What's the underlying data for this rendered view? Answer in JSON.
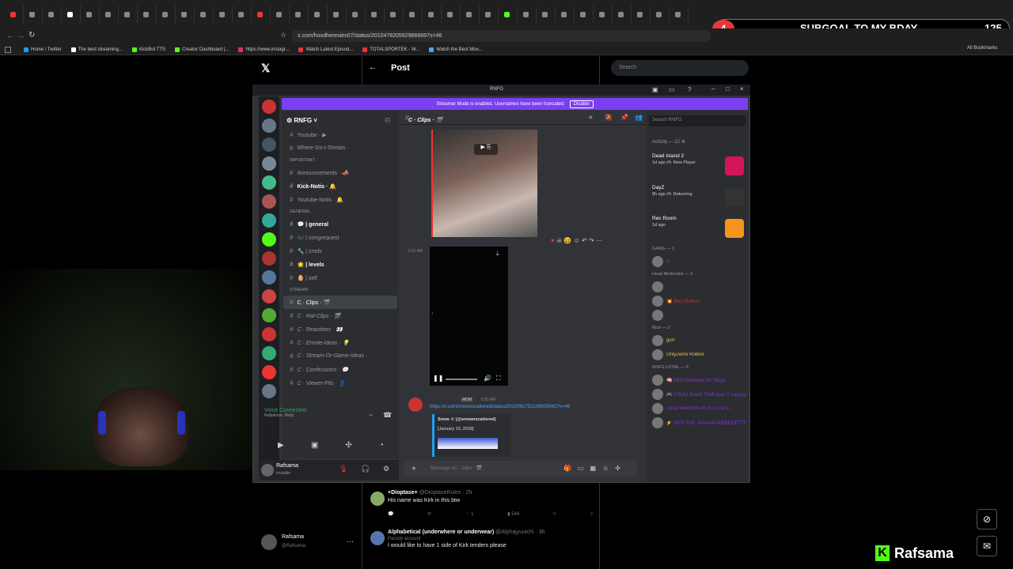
{
  "browser": {
    "url": "x.com/hoodheresies07/status/2010478205929666697s=46",
    "bookmarks": [
      "Home / Twitter",
      "The best streaming...",
      "KickBot TTS",
      "Creator Dashboard |...",
      "https://www.instagr...",
      "Watch Latest Episod...",
      "TOTALSPORTEK - W...",
      "Watch the Best Mov..."
    ],
    "all_bookmarks": "All Bookmarks",
    "bookmark_colors": [
      "#1d9bf0",
      "#fff",
      "#53fc18",
      "#53fc18",
      "#e1306c",
      "#e33",
      "#e33",
      "#4aa3ff"
    ]
  },
  "subgoal": {
    "number": "4",
    "title": "SUBGOAL TO MY BDAY",
    "count": "125"
  },
  "x": {
    "page_title": "Post",
    "search_placeholder": "Search",
    "account_name": "Rafsama",
    "account_handle": "@Rafsama",
    "replies": [
      {
        "name": "+Dioptase+",
        "handle": "@DioptaseRules · 2h",
        "text": "His name was Kirk in this btw",
        "stats": [
          "",
          "",
          "1",
          "548",
          "",
          ""
        ]
      },
      {
        "name": "Alphabetical (underwhere or underwear)",
        "handle": "@Alphajyuuichi · 3h",
        "badge": "Parody account",
        "text": "I would like to have 1 side of Kirk tenders please"
      }
    ]
  },
  "discord": {
    "window_title": "RNFG",
    "banner": "Streamer Mode is enabled. Usernames have been truncated.",
    "banner_button": "Disable",
    "server_name": "RNFG",
    "channels": [
      {
        "type": "ch",
        "label": "Youtube · ▶",
        "style": "dim"
      },
      {
        "type": "ch",
        "label": "Where-Do-I-Stream ·",
        "style": "dim"
      },
      {
        "type": "cat",
        "label": "Important ·"
      },
      {
        "type": "ch",
        "label": "Announcements · 📣",
        "style": "dim"
      },
      {
        "type": "ch",
        "label": "Kick-Notis · 🔔",
        "style": "bold"
      },
      {
        "type": "ch",
        "label": "Youtube-Notis · 🔔",
        "style": "dim"
      },
      {
        "type": "cat",
        "label": "GENERAL ·"
      },
      {
        "type": "ch",
        "label": "💬 | general",
        "style": "bold"
      },
      {
        "type": "ch",
        "label": "🎶 | songrequest",
        "style": "dim"
      },
      {
        "type": "ch",
        "label": "🔧 | cmds",
        "style": "dim"
      },
      {
        "type": "ch",
        "label": "🌟 | levels",
        "style": "bold"
      },
      {
        "type": "ch",
        "label": "🥚 | self",
        "style": "dim"
      },
      {
        "type": "cat",
        "label": "Stream ·"
      },
      {
        "type": "ch",
        "label": "C · Clips · 🎬",
        "style": "sel"
      },
      {
        "type": "ch",
        "label": "C · Raf-Clips · 🎬",
        "style": "ital"
      },
      {
        "type": "ch",
        "label": "C · Reactions · 👀",
        "style": "ital"
      },
      {
        "type": "ch",
        "label": "C · Emote-Ideas · 💡",
        "style": "ital"
      },
      {
        "type": "ch",
        "label": "C · Stream-Or-Game-Ideas ·",
        "style": "ital"
      },
      {
        "type": "ch",
        "label": "C · Confessions · 💬",
        "style": "ital"
      },
      {
        "type": "ch",
        "label": "C · Viewer-Fits · 👖",
        "style": "ital"
      }
    ],
    "voice": {
      "title": "Voice Connected",
      "sub": "Rafiphone, Molly"
    },
    "user": {
      "name": "Rafsama",
      "status": "Invisible"
    },
    "channel_header": "C · Clips · 🎬",
    "search_placeholder": "Search RNFG",
    "msg_time": "5:11 AM",
    "msg2": {
      "badge": "MOM",
      "time": "6:30 AM",
      "link": "https://x.com/snownscattered/status/2010061752109805942?s=46",
      "embed_author": "Snow ☆ (@snownscattered)",
      "embed_date": "[January 10, 2018]"
    },
    "input_placeholder": "Message #C · Clips · 🎬",
    "activity_header": "Activity — 22 ⚙",
    "games": [
      {
        "name": "Dead Island 2",
        "sub": "1d ago  🎮 New Player",
        "color": "#d4145a"
      },
      {
        "name": "DayZ",
        "sub": "8h ago  🎮 Returning",
        "color": "#333"
      },
      {
        "name": "Rec Room",
        "sub": "1d ago",
        "color": "#f7941d"
      }
    ],
    "members": [
      {
        "type": "h",
        "label": "GANG — 1"
      },
      {
        "type": "m",
        "label": "Z...",
        "color": "#c33"
      },
      {
        "type": "h",
        "label": "Head Moderator — 3"
      },
      {
        "type": "m",
        "label": "",
        "color": "#c33"
      },
      {
        "type": "m",
        "label": "💥 BAU  Roblox",
        "color": "#c33"
      },
      {
        "type": "m",
        "label": "",
        "color": "#c33"
      },
      {
        "type": "h",
        "label": "Rich — 2"
      },
      {
        "type": "m",
        "label": "gurt",
        "color": "#f5c542"
      },
      {
        "type": "m",
        "label": "OnlyZenni  Roblox",
        "color": "#f5c542"
      },
      {
        "type": "h",
        "label": "RNFG LOYAL — 6"
      },
      {
        "type": "m",
        "label": "🧠 DEO  Rainbow Six Siege",
        "color": "#8a2be2"
      },
      {
        "type": "m",
        "label": "🎮 CRUM  Grand Theft Auto V Legacy",
        "color": "#8a2be2"
      },
      {
        "type": "m",
        "label": "i pray everytime im in it, cuz s...",
        "color": "#8a2be2"
      },
      {
        "type": "m",
        "label": "⚡ HESI  THE JAAAAACKEEEEETTTT",
        "color": "#8a2be2"
      }
    ]
  },
  "stream": {
    "name": "Rafsama"
  }
}
